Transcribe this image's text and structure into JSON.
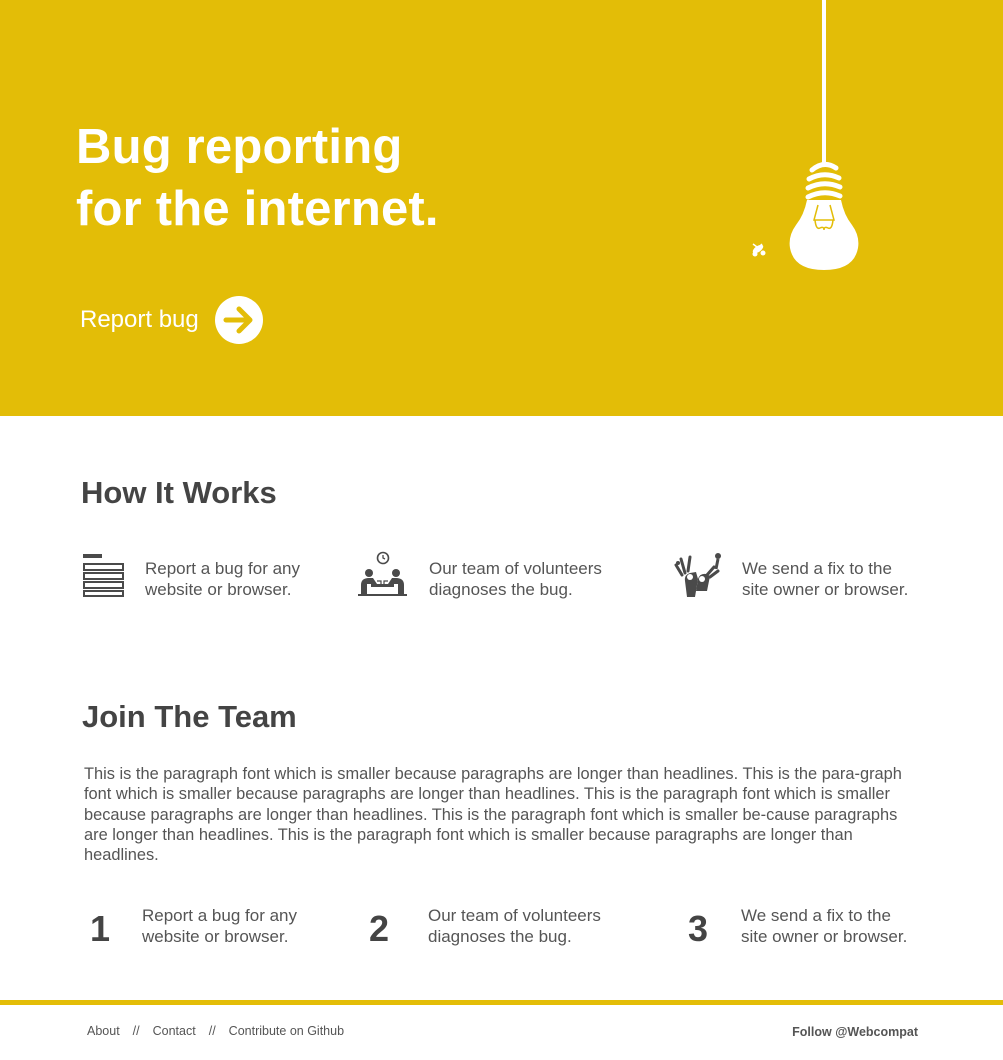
{
  "hero": {
    "title_line1": "Bug reporting",
    "title_line2": "for the internet.",
    "cta_label": "Report bug",
    "background_color": "#e3bd07"
  },
  "how_it_works": {
    "title": "How It Works",
    "steps": [
      {
        "icon": "report-list-icon",
        "line1": "Report a bug for any",
        "line2": "website or browser."
      },
      {
        "icon": "volunteers-icon",
        "line1": "Our team of volunteers",
        "line2": "diagnoses the bug."
      },
      {
        "icon": "celebration-icon",
        "line1": "We send a fix to the",
        "line2": "site owner or browser."
      }
    ]
  },
  "join_team": {
    "title": "Join The Team",
    "paragraph": "This is the paragraph font which is smaller because paragraphs are longer than headlines.  This is the para-graph font which is smaller because paragraphs are longer than headlines.  This is the paragraph font which is smaller because paragraphs are longer than headlines.  This is the paragraph font which is smaller be-cause paragraphs are longer than headlines.  This is the paragraph font which is smaller because paragraphs are longer than headlines.",
    "steps": [
      {
        "number": "1",
        "line1": "Report a bug for any",
        "line2": "website or browser."
      },
      {
        "number": "2",
        "line1": "Our team of volunteers",
        "line2": "diagnoses the bug."
      },
      {
        "number": "3",
        "line1": "We send a fix to the",
        "line2": "site owner or browser."
      }
    ]
  },
  "footer": {
    "links": [
      "About",
      "Contact",
      "Contribute on Github"
    ],
    "separator": "//",
    "follow": "Follow @Webcompat"
  }
}
